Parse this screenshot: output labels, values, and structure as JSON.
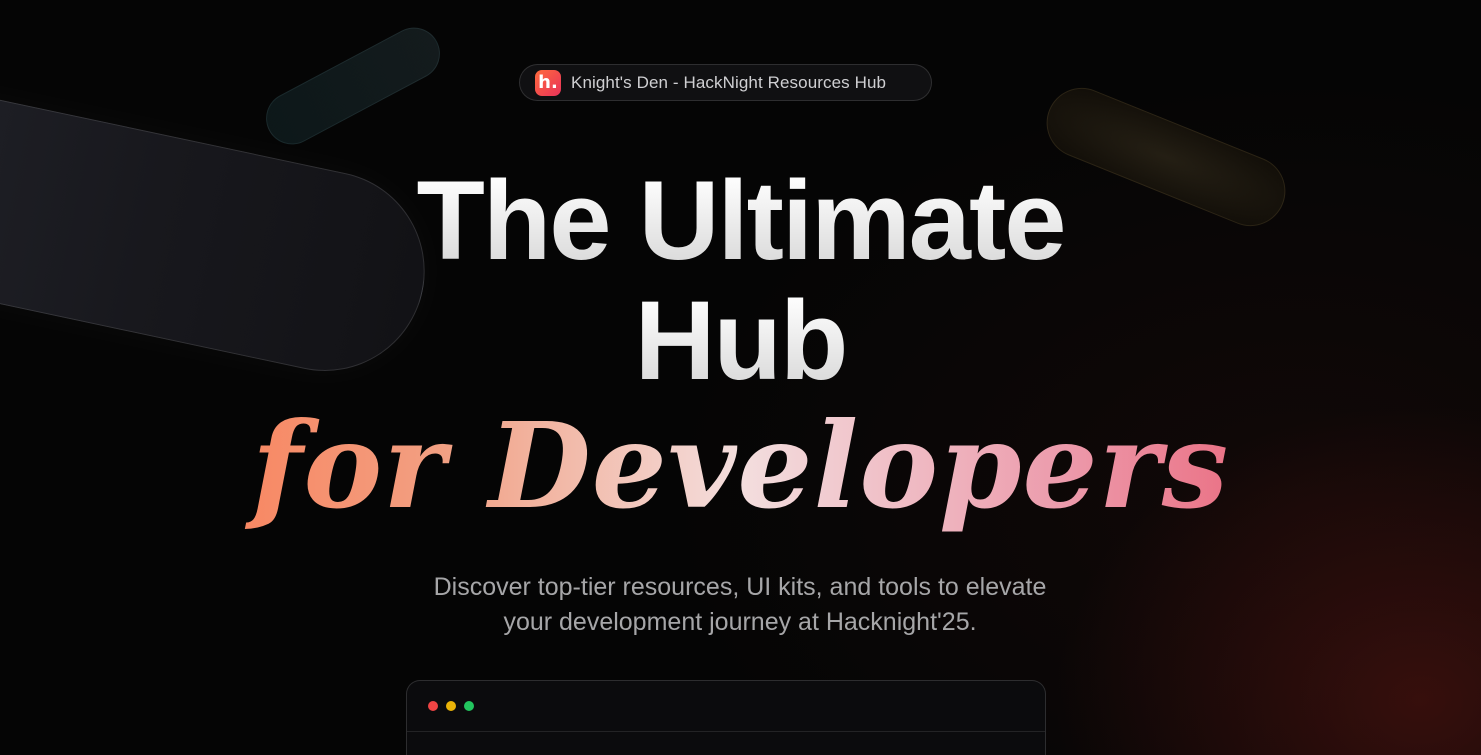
{
  "badge": {
    "logo_letter": "h.",
    "text": "Knight's Den - HackNight Resources Hub"
  },
  "hero": {
    "line1": "The Ultimate",
    "line2": "Hub",
    "script_line": "for Developers",
    "subtitle_line1": "Discover top-tier resources, UI kits, and tools to elevate",
    "subtitle_line2": "your development journey at Hacknight'25."
  },
  "window": {
    "dots": [
      "red-dot",
      "yellow-dot",
      "green-dot"
    ],
    "dot_colors": [
      "#ef4444",
      "#eab308",
      "#22c55e"
    ]
  },
  "colors": {
    "accent_start": "#ff6b3d",
    "accent_end": "#e8384f",
    "background": "#050505"
  }
}
